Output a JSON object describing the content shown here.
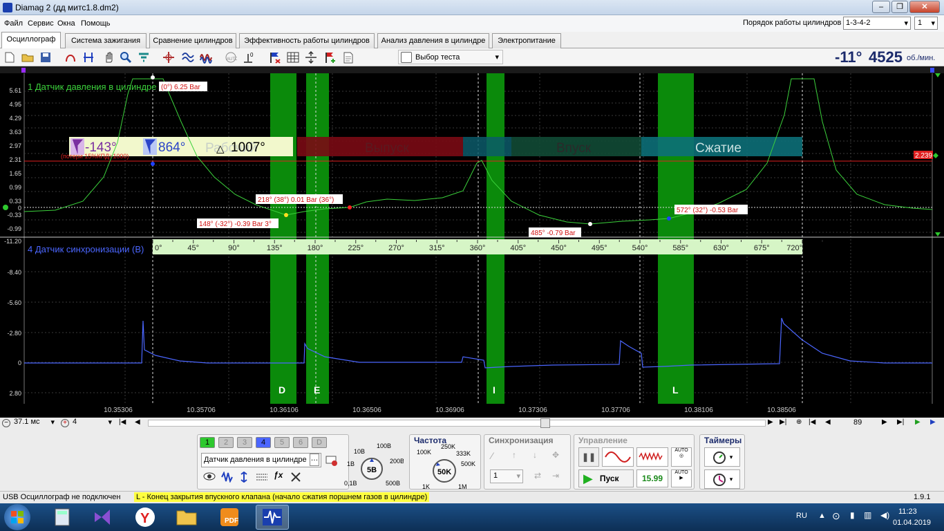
{
  "window": {
    "title": "Diamag 2 (дд митс1.8.dm2)"
  },
  "menu": [
    "Файл",
    "Сервис",
    "Окна",
    "Помощь"
  ],
  "firing_order": {
    "label": "Порядок работы цилиндров",
    "value": "1-3-4-2",
    "cylinder": "1"
  },
  "tabs": [
    "Осциллограф",
    "Система зажигания",
    "Сравнение цилиндров",
    "Эффективность работы цилиндров",
    "Анализ давления в цилиндре",
    "Электропитание"
  ],
  "toolbar": {
    "test_select": "Выбор теста",
    "rpm_angle": "-11°",
    "rpm_value": "4525",
    "rpm_unit": "об./мин."
  },
  "channel1": {
    "label": "1 Датчик давления в цилиндре",
    "color": "#3cd23c",
    "ticks": [
      "5.61",
      "4.95",
      "4.29",
      "3.63",
      "2.97",
      "2.31",
      "1.65",
      "0.99",
      "0.33",
      "0",
      "-0.33",
      "-0.99"
    ],
    "tick_values": [
      5.61,
      4.95,
      4.29,
      3.63,
      2.97,
      2.31,
      1.65,
      0.99,
      0.33,
      0,
      -0.33,
      -0.99
    ]
  },
  "channel4": {
    "label": "4 Датчик синхронизации (В)",
    "color": "#4b66ff",
    "ticks": [
      "-11.20",
      "-8.40",
      "-5.60",
      "-2.80",
      "0",
      "2.80"
    ]
  },
  "threshold": {
    "value": "2.239"
  },
  "overlay": {
    "angle1": "-143°",
    "angle2": "864°",
    "delta": "1007°",
    "phase_labels": [
      "Рабочий",
      "Выпуск",
      "Впуск",
      "Сжатие"
    ],
    "loss_note": "(потери 15%КПД>1000)"
  },
  "annotations": [
    "(0°) 6.25 Bar",
    "218° (38°) 0.01 Bar (36°)",
    "148° (-32°) -0.39 Bar 3°",
    "485° -0.79 Bar",
    "572° (32°) -0.53 Bar"
  ],
  "degree_scale": [
    "0°",
    "45°",
    "90°",
    "135°",
    "180°",
    "225°",
    "270°",
    "315°",
    "360°",
    "405°",
    "450°",
    "495°",
    "540°",
    "585°",
    "630°",
    "675°",
    "720°"
  ],
  "valve_markers": [
    "D",
    "E",
    "I",
    "L"
  ],
  "time_axis": [
    "10.35306",
    "10.35706",
    "10.36106",
    "10.36506",
    "10.36906",
    "10.37306",
    "10.37706",
    "10.38106",
    "10.38506"
  ],
  "footer": {
    "timebase": "37.1 мс",
    "channel": "4",
    "frame": "89"
  },
  "controls": {
    "channels": [
      "1",
      "2",
      "3",
      "4",
      "5",
      "6",
      "D"
    ],
    "channel_name": "Датчик давления в цилиндре",
    "volt_knob": {
      "value": "5В",
      "marks": [
        "10В",
        "100В",
        "200В",
        "500В",
        "0,1В",
        "1В"
      ]
    },
    "freq": {
      "title": "Частота",
      "value": "50K",
      "marks": [
        "100K",
        "250K",
        "333K",
        "500K",
        "1K",
        "1M"
      ]
    },
    "sync": {
      "title": "Синхронизация",
      "value": "1"
    },
    "control": {
      "title": "Управление",
      "start": "Пуск",
      "value": "15.99"
    },
    "timers": {
      "title": "Таймеры"
    }
  },
  "status": {
    "usb": "USB Осциллограф не подключен",
    "message": "L - Конец закрытия впускного клапана (начало сжатия поршнем газов в цилиндре)",
    "version": "1.9.1"
  },
  "taskbar": {
    "lang": "RU",
    "time": "11:23",
    "date": "01.04.2019"
  }
}
